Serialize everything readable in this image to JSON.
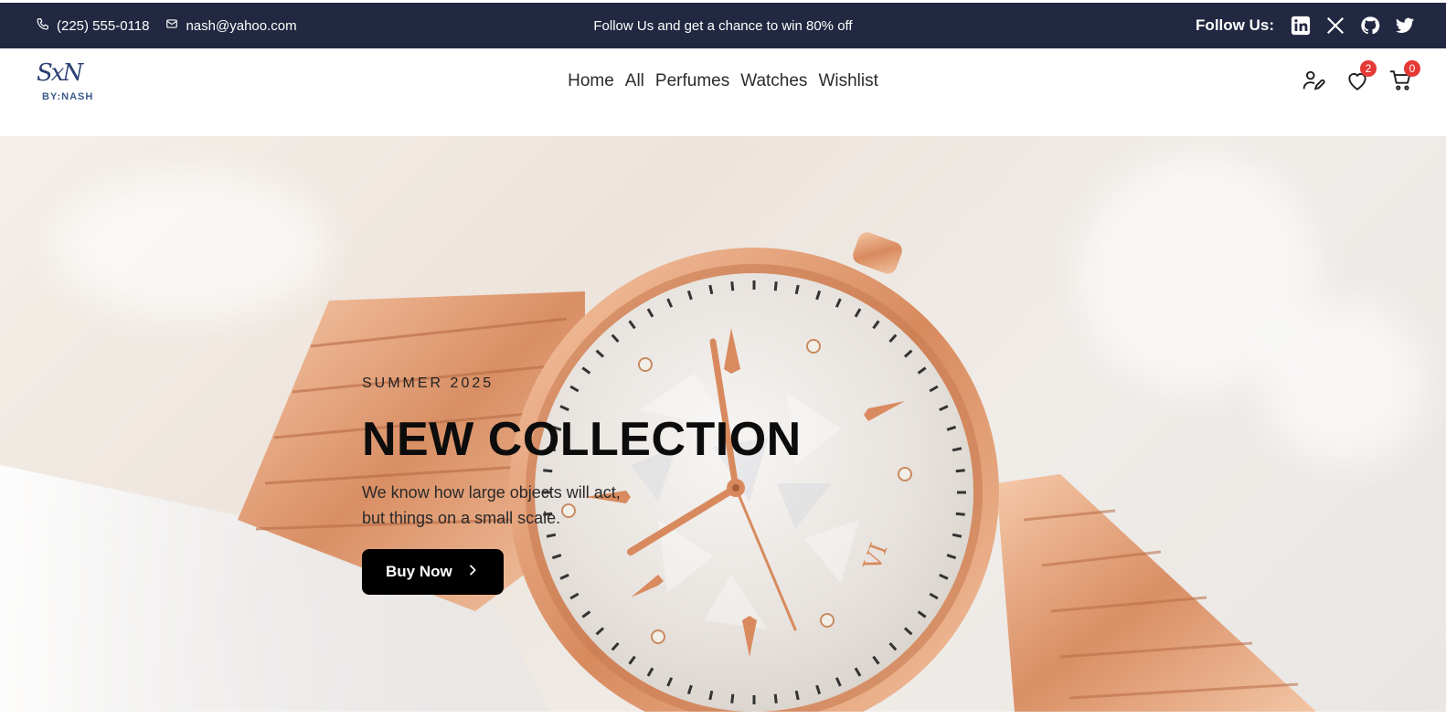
{
  "topbar": {
    "phone": "(225) 555-0118",
    "email": "nash@yahoo.com",
    "promo": "Follow Us and get a chance to win 80% off",
    "follow_label": "Follow Us:",
    "social_icons": [
      "linkedin-icon",
      "x-icon",
      "github-icon",
      "twitter-icon"
    ],
    "background": "#222841"
  },
  "header": {
    "logo_mark": "SxN",
    "logo_sub": "BY:NASH",
    "nav": [
      "Home",
      "All",
      "Perfumes",
      "Watches",
      "Wishlist"
    ],
    "wishlist_count": "2",
    "cart_count": "0",
    "badge_color": "#e53935"
  },
  "hero": {
    "kicker": "SUMMER 2025",
    "title": "NEW COLLECTION",
    "desc_line1": "We know how large objects will act,",
    "desc_line2": "but things on a small scale.",
    "button_label": "Buy Now"
  }
}
